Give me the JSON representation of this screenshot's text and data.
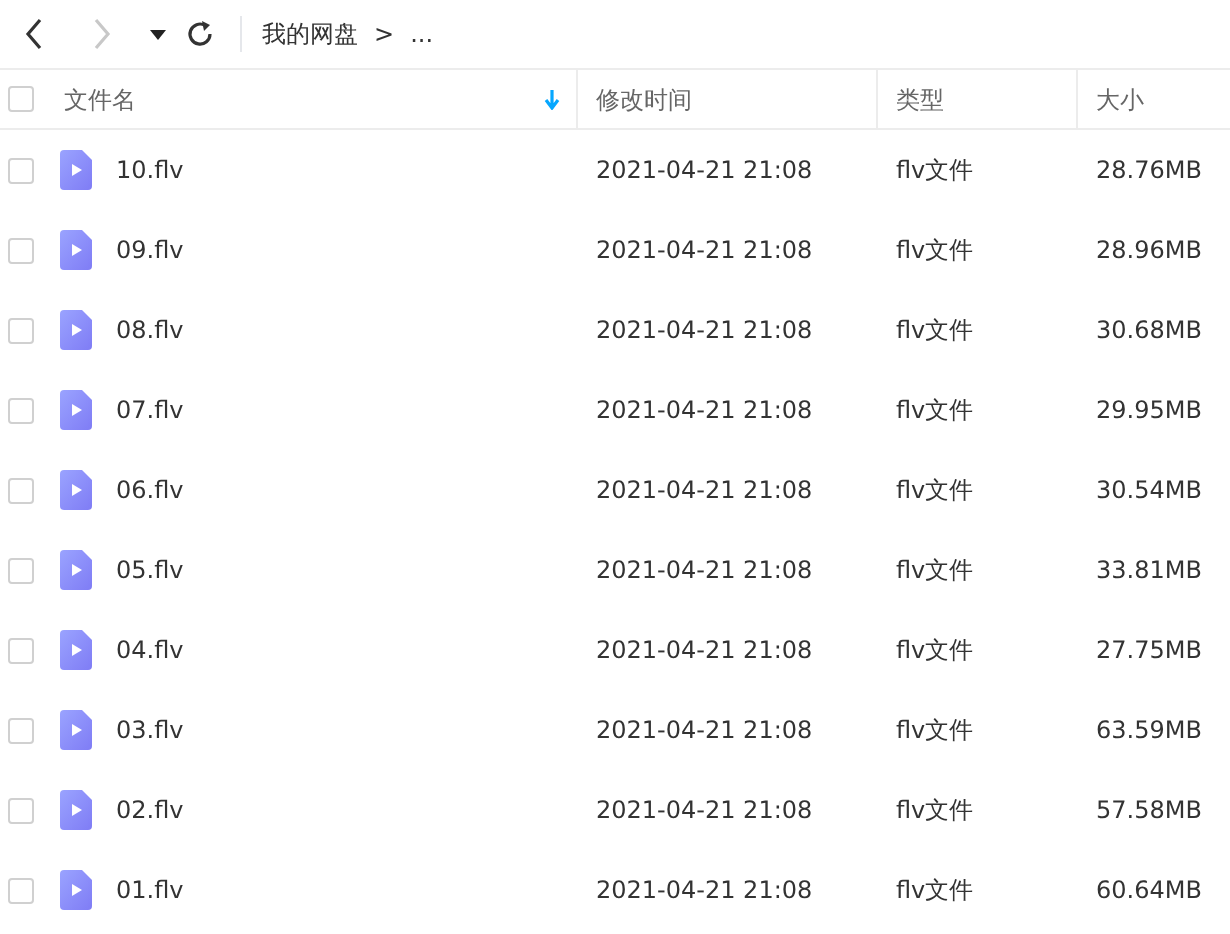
{
  "toolbar": {
    "back": {
      "disabled": false
    },
    "forward": {
      "disabled": true
    },
    "breadcrumb": [
      {
        "label": "我的网盘"
      },
      {
        "label": "..."
      }
    ],
    "separator": ">"
  },
  "table": {
    "select_all": {
      "checked": false
    },
    "columns": [
      {
        "label": "文件名",
        "sorted": true
      },
      {
        "label": "修改时间",
        "sorted": false
      },
      {
        "label": "类型",
        "sorted": false
      },
      {
        "label": "大小",
        "sorted": false
      }
    ],
    "rows": [
      {
        "checked": false,
        "name": "10.flv",
        "modified": "2021-04-21 21:08",
        "type": "flv文件",
        "size": "28.76MB"
      },
      {
        "checked": false,
        "name": "09.flv",
        "modified": "2021-04-21 21:08",
        "type": "flv文件",
        "size": "28.96MB"
      },
      {
        "checked": false,
        "name": "08.flv",
        "modified": "2021-04-21 21:08",
        "type": "flv文件",
        "size": "30.68MB"
      },
      {
        "checked": false,
        "name": "07.flv",
        "modified": "2021-04-21 21:08",
        "type": "flv文件",
        "size": "29.95MB"
      },
      {
        "checked": false,
        "name": "06.flv",
        "modified": "2021-04-21 21:08",
        "type": "flv文件",
        "size": "30.54MB"
      },
      {
        "checked": false,
        "name": "05.flv",
        "modified": "2021-04-21 21:08",
        "type": "flv文件",
        "size": "33.81MB"
      },
      {
        "checked": false,
        "name": "04.flv",
        "modified": "2021-04-21 21:08",
        "type": "flv文件",
        "size": "27.75MB"
      },
      {
        "checked": false,
        "name": "03.flv",
        "modified": "2021-04-21 21:08",
        "type": "flv文件",
        "size": "63.59MB"
      },
      {
        "checked": false,
        "name": "02.flv",
        "modified": "2021-04-21 21:08",
        "type": "flv文件",
        "size": "57.58MB"
      },
      {
        "checked": false,
        "name": "01.flv",
        "modified": "2021-04-21 21:08",
        "type": "flv文件",
        "size": "60.64MB"
      }
    ]
  }
}
